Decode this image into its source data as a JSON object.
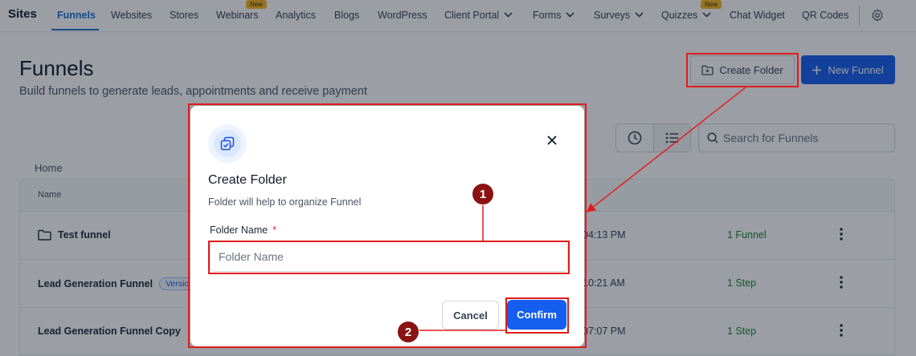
{
  "nav": {
    "brand": "Sites",
    "items": [
      {
        "label": "Funnels"
      },
      {
        "label": "Websites"
      },
      {
        "label": "Stores"
      },
      {
        "label": "Webinars",
        "badge": "New"
      },
      {
        "label": "Analytics"
      },
      {
        "label": "Blogs"
      },
      {
        "label": "WordPress"
      },
      {
        "label": "Client Portal"
      },
      {
        "label": "Forms"
      },
      {
        "label": "Surveys"
      },
      {
        "label": "Quizzes",
        "badge": "New"
      },
      {
        "label": "Chat Widget"
      },
      {
        "label": "QR Codes"
      }
    ]
  },
  "page": {
    "title": "Funnels",
    "subtitle": "Build funnels to generate leads, appointments and receive payment",
    "create_folder_label": "Create Folder",
    "new_funnel_label": "New Funnel",
    "search_placeholder": "Search for Funnels",
    "breadcrumb": "Home"
  },
  "table": {
    "name_header": "Name",
    "rows": [
      {
        "name": "Test funnel",
        "time": "04:13 PM",
        "count": "1 Funnel"
      },
      {
        "name": "Lead Generation Funnel",
        "badge": "Versio",
        "time": "10:21 AM",
        "count": "1 Step"
      },
      {
        "name": "Lead Generation Funnel Copy",
        "time": "07:07 PM",
        "count": "1 Step"
      }
    ]
  },
  "modal": {
    "title": "Create Folder",
    "description": "Folder will help to organize Funnel",
    "field_label": "Folder Name",
    "required_mark": "*",
    "input_placeholder": "Folder Name",
    "cancel_label": "Cancel",
    "confirm_label": "Confirm"
  },
  "annotations": {
    "step_1": "1",
    "step_2": "2",
    "color": "#e01b1b"
  },
  "colors": {
    "primary": "#155eef",
    "active_nav": "#1d6fd1",
    "success": "#16803c",
    "badge_new": "#f5b921"
  }
}
